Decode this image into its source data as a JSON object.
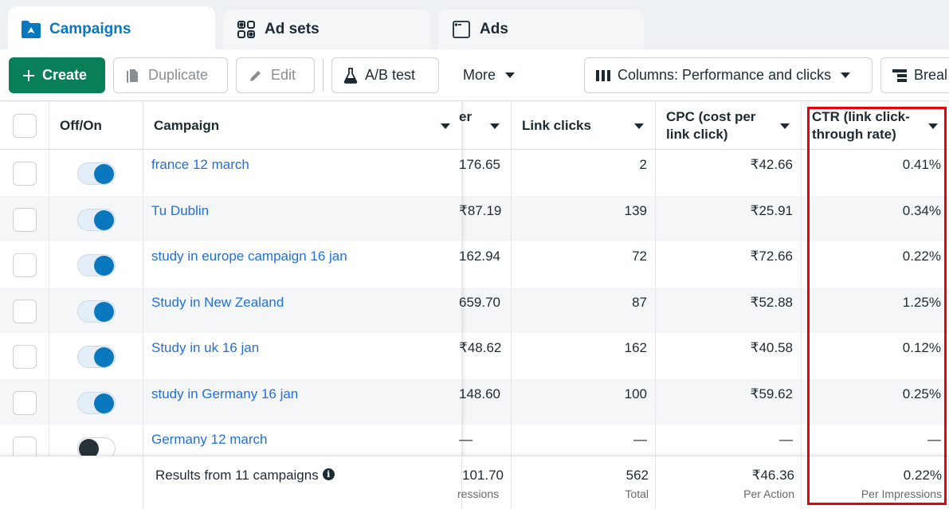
{
  "tabs": [
    {
      "label": "Campaigns",
      "icon": "folder-campaign-icon",
      "active": true
    },
    {
      "label": "Ad sets",
      "icon": "grid-icon",
      "active": false
    },
    {
      "label": "Ads",
      "icon": "window-icon",
      "active": false
    }
  ],
  "toolbar": {
    "create_label": "Create",
    "duplicate_label": "Duplicate",
    "edit_label": "Edit",
    "ab_test_label": "A/B test",
    "more_label": "More",
    "columns_label": "Columns: Performance and clicks",
    "breakdown_label": "Breal"
  },
  "table": {
    "headers": {
      "off_on": "Off/On",
      "campaign": "Campaign",
      "partial": "er",
      "link_clicks": "Link clicks",
      "cpc_line1": "CPC (cost per",
      "cpc_line2": "link click)",
      "ctr_line1": "CTR (link click-",
      "ctr_line2": "through rate)"
    },
    "rows": [
      {
        "name": "france 12 march",
        "on": true,
        "partial": "176.65",
        "link_clicks": "2",
        "cpc": "₹42.66",
        "ctr": "0.41%"
      },
      {
        "name": "Tu Dublin",
        "on": true,
        "partial": "₹87.19",
        "link_clicks": "139",
        "cpc": "₹25.91",
        "ctr": "0.34%"
      },
      {
        "name": "study in europe campaign 16 jan",
        "on": true,
        "partial": "162.94",
        "link_clicks": "72",
        "cpc": "₹72.66",
        "ctr": "0.22%"
      },
      {
        "name": "Study in New Zealand",
        "on": true,
        "partial": "659.70",
        "link_clicks": "87",
        "cpc": "₹52.88",
        "ctr": "1.25%"
      },
      {
        "name": "Study in uk 16 jan",
        "on": true,
        "partial": "₹48.62",
        "link_clicks": "162",
        "cpc": "₹40.58",
        "ctr": "0.12%"
      },
      {
        "name": "study in Germany 16 jan",
        "on": true,
        "partial": "148.60",
        "link_clicks": "100",
        "cpc": "₹59.62",
        "ctr": "0.25%"
      },
      {
        "name": "Germany 12 march",
        "on": false,
        "partial": "—",
        "link_clicks": "—",
        "cpc": "—",
        "ctr": "—"
      }
    ],
    "footer": {
      "results_label": "Results from 11 campaigns",
      "partial_value": "101.70",
      "partial_sub": "ressions",
      "link_clicks_value": "562",
      "link_clicks_sub": "Total",
      "cpc_value": "₹46.36",
      "cpc_sub": "Per Action",
      "ctr_value": "0.22%",
      "ctr_sub": "Per Impressions"
    }
  },
  "colors": {
    "accent": "#0a78be",
    "create_button": "#087f58",
    "link": "#216fdb",
    "highlight_box": "#e8000b"
  }
}
